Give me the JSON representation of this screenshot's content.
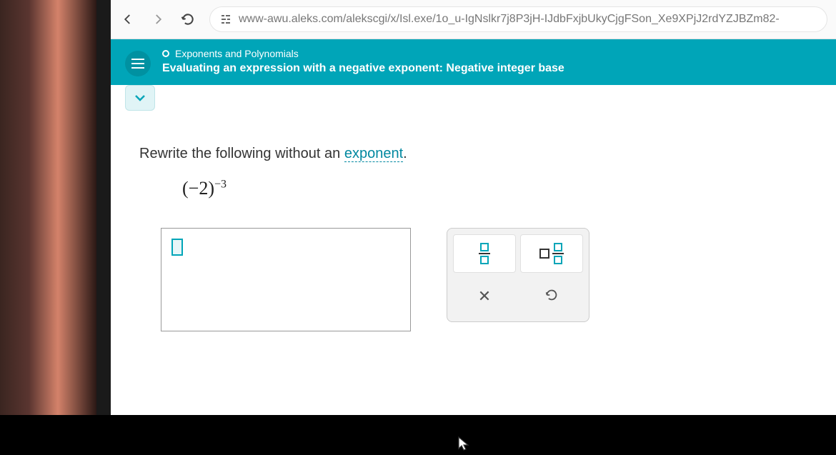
{
  "browser": {
    "url": "www-awu.aleks.com/alekscgi/x/Isl.exe/1o_u-IgNslkr7j8P3jH-IJdbFxjbUkyCjgFSon_Xe9XPjJ2rdYZJBZm82-"
  },
  "header": {
    "category": "Exponents and Polynomials",
    "title": "Evaluating an expression with a negative exponent: Negative integer base"
  },
  "question": {
    "prompt_prefix": "Rewrite the following without an ",
    "prompt_link": "exponent",
    "prompt_suffix": ".",
    "base": "(−2)",
    "exponent": "−3"
  },
  "tools": {
    "fraction": "fraction",
    "mixed": "mixed-number",
    "clear": "clear",
    "undo": "undo"
  }
}
